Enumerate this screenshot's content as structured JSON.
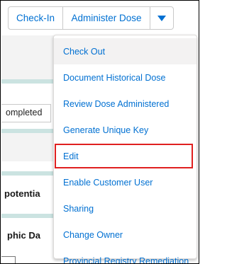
{
  "toolbar": {
    "checkin_label": "Check-In",
    "administer_label": "Administer Dose",
    "menu_icon": "triangle-down-icon"
  },
  "background": {
    "completed_text": "ompleted",
    "potential_text": "potentia",
    "demographic_text": "phic Da"
  },
  "menu": {
    "items": [
      {
        "label": "Check Out"
      },
      {
        "label": "Document Historical Dose"
      },
      {
        "label": "Review Dose Administered"
      },
      {
        "label": "Generate Unique Key"
      },
      {
        "label": "Edit"
      },
      {
        "label": "Enable Customer User"
      },
      {
        "label": "Sharing"
      },
      {
        "label": "Change Owner"
      },
      {
        "label": "Provincial Registry Remediation"
      }
    ]
  },
  "colors": {
    "accent": "#0070d2",
    "highlight_border": "#e02020",
    "teal_strip": "#cbe3e1"
  }
}
